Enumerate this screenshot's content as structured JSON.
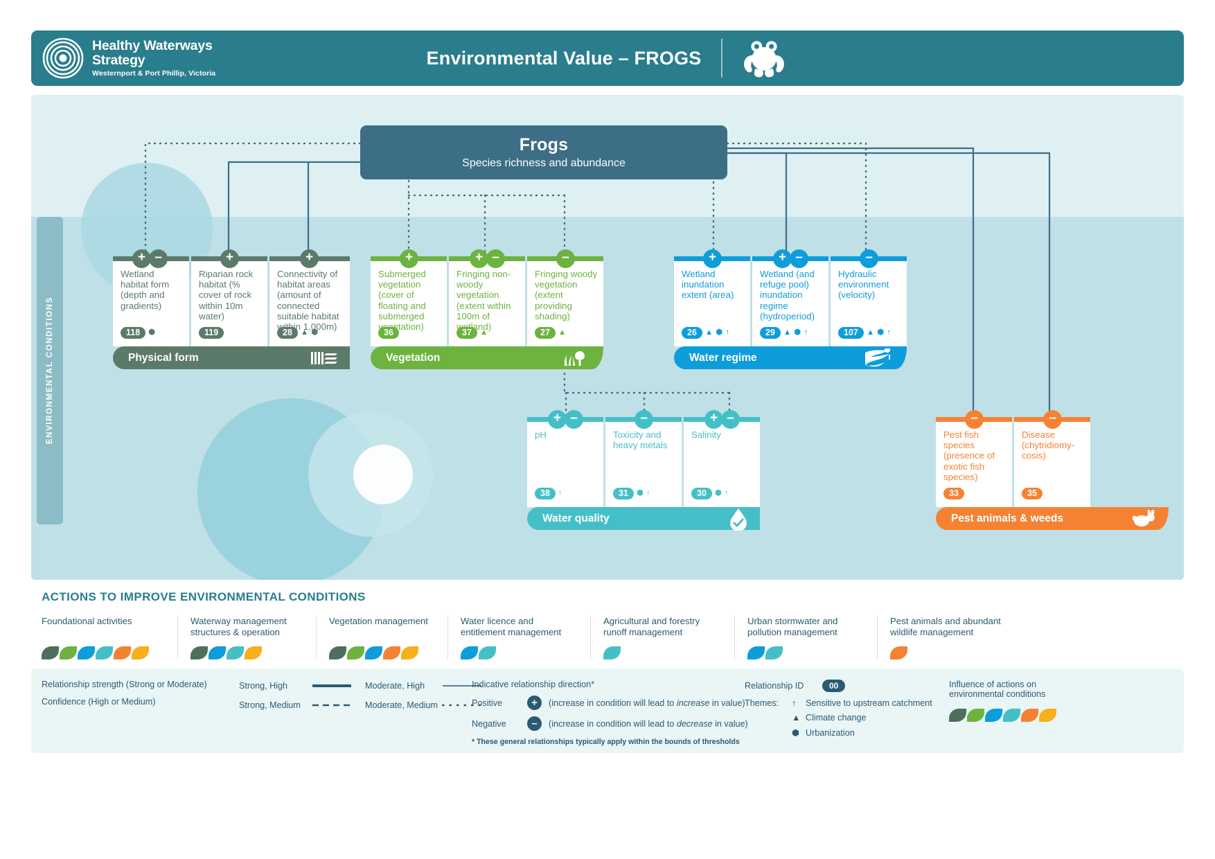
{
  "header": {
    "logo_line1": "Healthy Waterways",
    "logo_line2": "Strategy",
    "logo_line3": "Westernport & Port Phillip, Victoria",
    "title": "Environmental Value – FROGS",
    "logo_icon": "spiral-waterways-logo",
    "subject_icon": "frog-icon"
  },
  "side_label": "ENVIRONMENTAL CONDITIONS",
  "ev_box": {
    "title": "Frogs",
    "subtitle": "Species richness and abundance"
  },
  "colors": {
    "physical_form": "#5c7a6a",
    "vegetation": "#6cb33f",
    "water_regime": "#0d9ddb",
    "water_quality": "#45bfc7",
    "pest": "#f58233",
    "header_teal": "#2a7d8c",
    "ev_box": "#3c6e85",
    "canvas": "#dff0f3",
    "band": "#bfe0e6"
  },
  "groups": [
    {
      "id": "physical-form",
      "name": "Physical form",
      "color": "#5c7a6a",
      "icon": "rock-habitat-icon",
      "cards": [
        {
          "label": "Wetland habitat form (depth and gradients)",
          "badge": "118",
          "signs": [
            "+",
            "-"
          ],
          "themes": [
            "urbanization"
          ]
        },
        {
          "label": "Riparian rock habitat (% cover of rock within 10m water)",
          "badge": "119",
          "signs": [
            "+"
          ],
          "themes": []
        },
        {
          "label": "Connectivity of habitat areas (amount of connected suitable habitat within 1,000m)",
          "badge": "28",
          "signs": [
            "+"
          ],
          "themes": [
            "climate-change",
            "urbanization"
          ]
        }
      ]
    },
    {
      "id": "vegetation",
      "name": "Vegetation",
      "color": "#6cb33f",
      "icon": "tree-grass-icon",
      "cards": [
        {
          "label": "Submerged vegetation (cover of floating and submerged vegetation)",
          "badge": "36",
          "signs": [
            "+"
          ],
          "themes": []
        },
        {
          "label": "Fringing non-woody vegetation (extent within 100m of wetland)",
          "badge": "37",
          "signs": [
            "+",
            "-"
          ],
          "themes": [
            "climate-change"
          ]
        },
        {
          "label": "Fringing woody vegetation (extent providing shading)",
          "badge": "27",
          "signs": [
            "-"
          ],
          "themes": [
            "climate-change"
          ]
        }
      ]
    },
    {
      "id": "water-regime",
      "name": "Water regime",
      "color": "#0d9ddb",
      "icon": "river-flow-icon",
      "cards": [
        {
          "label": "Wetland inundation extent (area)",
          "badge": "26",
          "signs": [
            "+"
          ],
          "themes": [
            "climate-change",
            "urbanization",
            "upstream"
          ]
        },
        {
          "label": "Wetland (and refuge pool) inundation regime (hydroperiod)",
          "badge": "29",
          "signs": [
            "+",
            "-"
          ],
          "themes": [
            "climate-change",
            "urbanization",
            "upstream"
          ]
        },
        {
          "label": "Hydraulic environment (velocity)",
          "badge": "107",
          "signs": [
            "-"
          ],
          "themes": [
            "climate-change",
            "urbanization",
            "upstream"
          ]
        }
      ]
    },
    {
      "id": "water-quality",
      "name": "Water quality",
      "color": "#45bfc7",
      "icon": "water-drop-tick-icon",
      "cards": [
        {
          "label": "pH",
          "badge": "38",
          "signs": [
            "+",
            "-"
          ],
          "themes": [
            "upstream"
          ]
        },
        {
          "label": "Toxicity and heavy metals",
          "badge": "31",
          "signs": [
            "-"
          ],
          "themes": [
            "urbanization",
            "upstream"
          ]
        },
        {
          "label": "Salinity",
          "badge": "30",
          "signs": [
            "+",
            "-"
          ],
          "themes": [
            "urbanization",
            "upstream"
          ]
        }
      ]
    },
    {
      "id": "pest-animals-weeds",
      "name": "Pest animals & weeds",
      "color": "#f58233",
      "icon": "rabbit-icon",
      "cards": [
        {
          "label": "Pest fish species (presence of exotic fish species)",
          "badge": "33",
          "signs": [
            "-"
          ],
          "themes": []
        },
        {
          "label": "Disease (chytridiomycosis)",
          "label_display": "Disease (chytridiomy-cosis)",
          "badge": "35",
          "signs": [
            "-"
          ],
          "themes": []
        }
      ]
    }
  ],
  "actions": {
    "title": "ACTIONS TO IMPROVE ENVIRONMENTAL CONDITIONS",
    "columns": [
      {
        "label": "Foundational activities",
        "leaves": [
          "#4f6f5e",
          "#6cb33f",
          "#0d9ddb",
          "#45bfc7",
          "#f58233",
          "#f9ae1b"
        ]
      },
      {
        "label": "Waterway management structures & operation",
        "leaves": [
          "#4f6f5e",
          "#0d9ddb",
          "#45bfc7",
          "#f9ae1b"
        ]
      },
      {
        "label": "Vegetation management",
        "leaves": [
          "#4f6f5e",
          "#6cb33f",
          "#0d9ddb",
          "#f58233",
          "#f9ae1b"
        ]
      },
      {
        "label": "Water licence and entitlement management",
        "leaves": [
          "#0d9ddb",
          "#45bfc7"
        ]
      },
      {
        "label": "Agricultural and forestry runoff management",
        "leaves": [
          "#45bfc7"
        ]
      },
      {
        "label": "Urban stormwater and pollution management",
        "leaves": [
          "#0d9ddb",
          "#45bfc7"
        ]
      },
      {
        "label": "Pest animals and abundant wildlife management",
        "leaves": [
          "#f58233"
        ]
      }
    ]
  },
  "legend": {
    "strength_line1": "Relationship strength  (Strong or Moderate)",
    "strength_line2": "Confidence  (High or Medium)",
    "lines": [
      {
        "name": "Strong, High",
        "style": "solid-thick"
      },
      {
        "name": "Moderate, High",
        "style": "solid-thin"
      },
      {
        "name": "Strong, Medium",
        "style": "dashed"
      },
      {
        "name": "Moderate, Medium",
        "style": "dotted"
      }
    ],
    "direction_title": "Indicative relationship direction*",
    "positive_label": "Positive",
    "positive_desc_a": "(increase in condition will lead to ",
    "positive_desc_i": "increase",
    "positive_desc_b": " in value)",
    "negative_label": "Negative",
    "negative_desc_a": "(increase in condition will lead to ",
    "negative_desc_i": "decrease",
    "negative_desc_b": " in value)",
    "footnote": "* These general relationships typically apply within the bounds of thresholds",
    "relationship_id_label": "Relationship ID",
    "relationship_id_value": "00",
    "themes_label": "Themes:",
    "themes": [
      {
        "icon": "up-arrow-icon",
        "glyph": "↑",
        "label": "Sensitive to upstream catchment"
      },
      {
        "icon": "triangle-icon",
        "glyph": "▲",
        "label": "Climate change"
      },
      {
        "icon": "hexagon-icon",
        "glyph": "⬢",
        "label": "Urbanization"
      }
    ],
    "influence_line1": "Influence of actions on",
    "influence_line2": "environmental conditions",
    "influence_leaves": [
      "#4f6f5e",
      "#6cb33f",
      "#0d9ddb",
      "#45bfc7",
      "#f58233",
      "#f9ae1b"
    ]
  }
}
